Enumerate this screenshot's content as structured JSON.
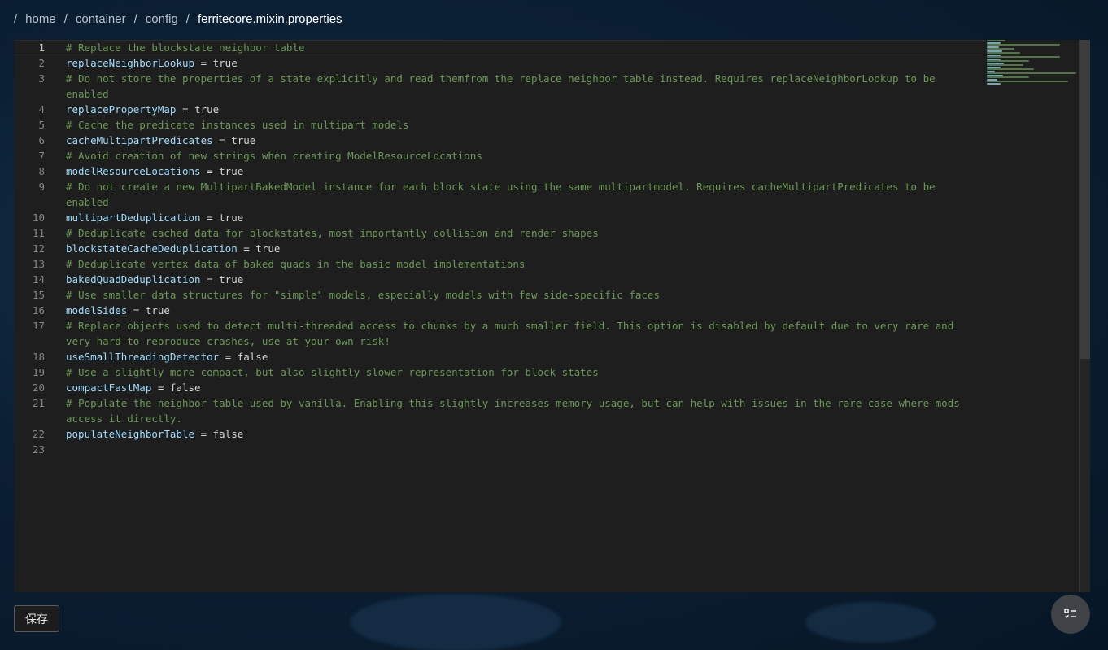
{
  "breadcrumb": {
    "separator": "/",
    "items": [
      "home",
      "container",
      "config",
      "ferritecore.mixin.properties"
    ]
  },
  "editor": {
    "lines": [
      {
        "n": "1",
        "type": "comment",
        "text": "# Replace the blockstate neighbor table"
      },
      {
        "n": "2",
        "type": "prop",
        "key": "replaceNeighborLookup",
        "value": "true"
      },
      {
        "n": "3",
        "type": "comment",
        "text": "# Do not store the properties of a state explicitly and read themfrom the replace neighbor table instead. Requires replaceNeighborLookup to be enabled"
      },
      {
        "n": "4",
        "type": "prop",
        "key": "replacePropertyMap",
        "value": "true"
      },
      {
        "n": "5",
        "type": "comment",
        "text": "# Cache the predicate instances used in multipart models"
      },
      {
        "n": "6",
        "type": "prop",
        "key": "cacheMultipartPredicates",
        "value": "true"
      },
      {
        "n": "7",
        "type": "comment",
        "text": "# Avoid creation of new strings when creating ModelResourceLocations"
      },
      {
        "n": "8",
        "type": "prop",
        "key": "modelResourceLocations",
        "value": "true"
      },
      {
        "n": "9",
        "type": "comment",
        "text": "# Do not create a new MultipartBakedModel instance for each block state using the same multipartmodel. Requires cacheMultipartPredicates to be enabled"
      },
      {
        "n": "10",
        "type": "prop",
        "key": "multipartDeduplication",
        "value": "true"
      },
      {
        "n": "11",
        "type": "comment",
        "text": "# Deduplicate cached data for blockstates, most importantly collision and render shapes"
      },
      {
        "n": "12",
        "type": "prop",
        "key": "blockstateCacheDeduplication",
        "value": "true"
      },
      {
        "n": "13",
        "type": "comment",
        "text": "# Deduplicate vertex data of baked quads in the basic model implementations"
      },
      {
        "n": "14",
        "type": "prop",
        "key": "bakedQuadDeduplication",
        "value": "true"
      },
      {
        "n": "15",
        "type": "comment",
        "text": "# Use smaller data structures for \"simple\" models, especially models with few side-specific faces"
      },
      {
        "n": "16",
        "type": "prop",
        "key": "modelSides",
        "value": "true"
      },
      {
        "n": "17",
        "type": "comment",
        "text": "# Replace objects used to detect multi-threaded access to chunks by a much smaller field. This option is disabled by default due to very rare and very hard-to-reproduce crashes, use at your own risk!"
      },
      {
        "n": "18",
        "type": "prop",
        "key": "useSmallThreadingDetector",
        "value": "false"
      },
      {
        "n": "19",
        "type": "comment",
        "text": "# Use a slightly more compact, but also slightly slower representation for block states"
      },
      {
        "n": "20",
        "type": "prop",
        "key": "compactFastMap",
        "value": "false"
      },
      {
        "n": "21",
        "type": "comment",
        "text": "# Populate the neighbor table used by vanilla. Enabling this slightly increases memory usage, but can help with issues in the rare case where mods access it directly."
      },
      {
        "n": "22",
        "type": "prop",
        "key": "populateNeighborTable",
        "value": "false"
      },
      {
        "n": "23",
        "type": "empty",
        "text": ""
      }
    ],
    "operator": " = "
  },
  "actions": {
    "save_label": "保存"
  },
  "colors": {
    "comment": "#6a9955",
    "key": "#9cdcfe",
    "editor_bg": "#1e1e1e"
  },
  "icons": {
    "fab": "checklist-icon"
  }
}
